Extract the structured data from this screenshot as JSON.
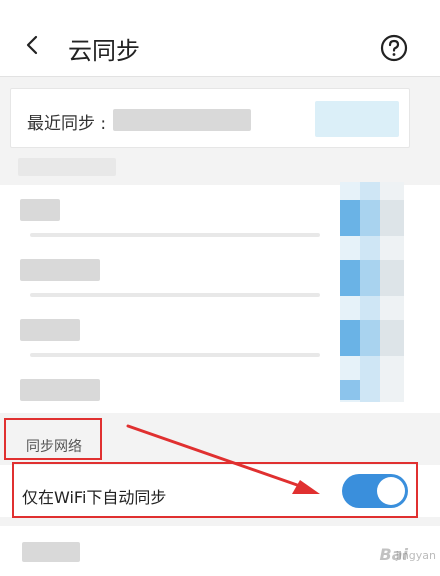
{
  "header": {
    "title": "云同步"
  },
  "last_sync": {
    "label": "最近同步 :"
  },
  "network_section": {
    "title": "同步网络",
    "wifi_only": {
      "label": "仅在WiFi下自动同步",
      "enabled": true
    }
  },
  "watermark": {
    "brand": "Bai",
    "sub": "jingyan"
  },
  "colors": {
    "toggle_on": "#3a8fdc",
    "annotation_red": "#e03030"
  }
}
